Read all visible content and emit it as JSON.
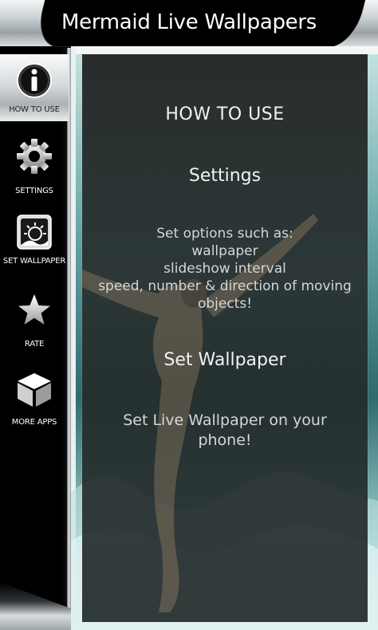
{
  "header": {
    "title": "Mermaid Live Wallpapers"
  },
  "sidebar": {
    "items": [
      {
        "label": "HOW TO USE",
        "icon": "info-icon",
        "active": true
      },
      {
        "label": "SETTINGS",
        "icon": "gear-icon",
        "active": false
      },
      {
        "label": "SET WALLPAPER",
        "icon": "set-wallpaper-icon",
        "active": false
      },
      {
        "label": "RATE",
        "icon": "star-icon",
        "active": false
      },
      {
        "label": "MORE APPS",
        "icon": "cube-icon",
        "active": false
      }
    ]
  },
  "main": {
    "heading": "HOW TO USE",
    "settings_title": "Settings",
    "settings_body": [
      "Set options such as:",
      "wallpaper",
      "slideshow interval",
      "speed, number & direction of moving",
      "objects!"
    ],
    "set_wallpaper_title": "Set Wallpaper",
    "set_wallpaper_body": [
      "Set Live Wallpaper on your",
      "phone!"
    ]
  },
  "colors": {
    "header_black": "#000000",
    "text": "#ffffff",
    "panel": "#262a2a",
    "sea_accent": "#4d8f91"
  }
}
